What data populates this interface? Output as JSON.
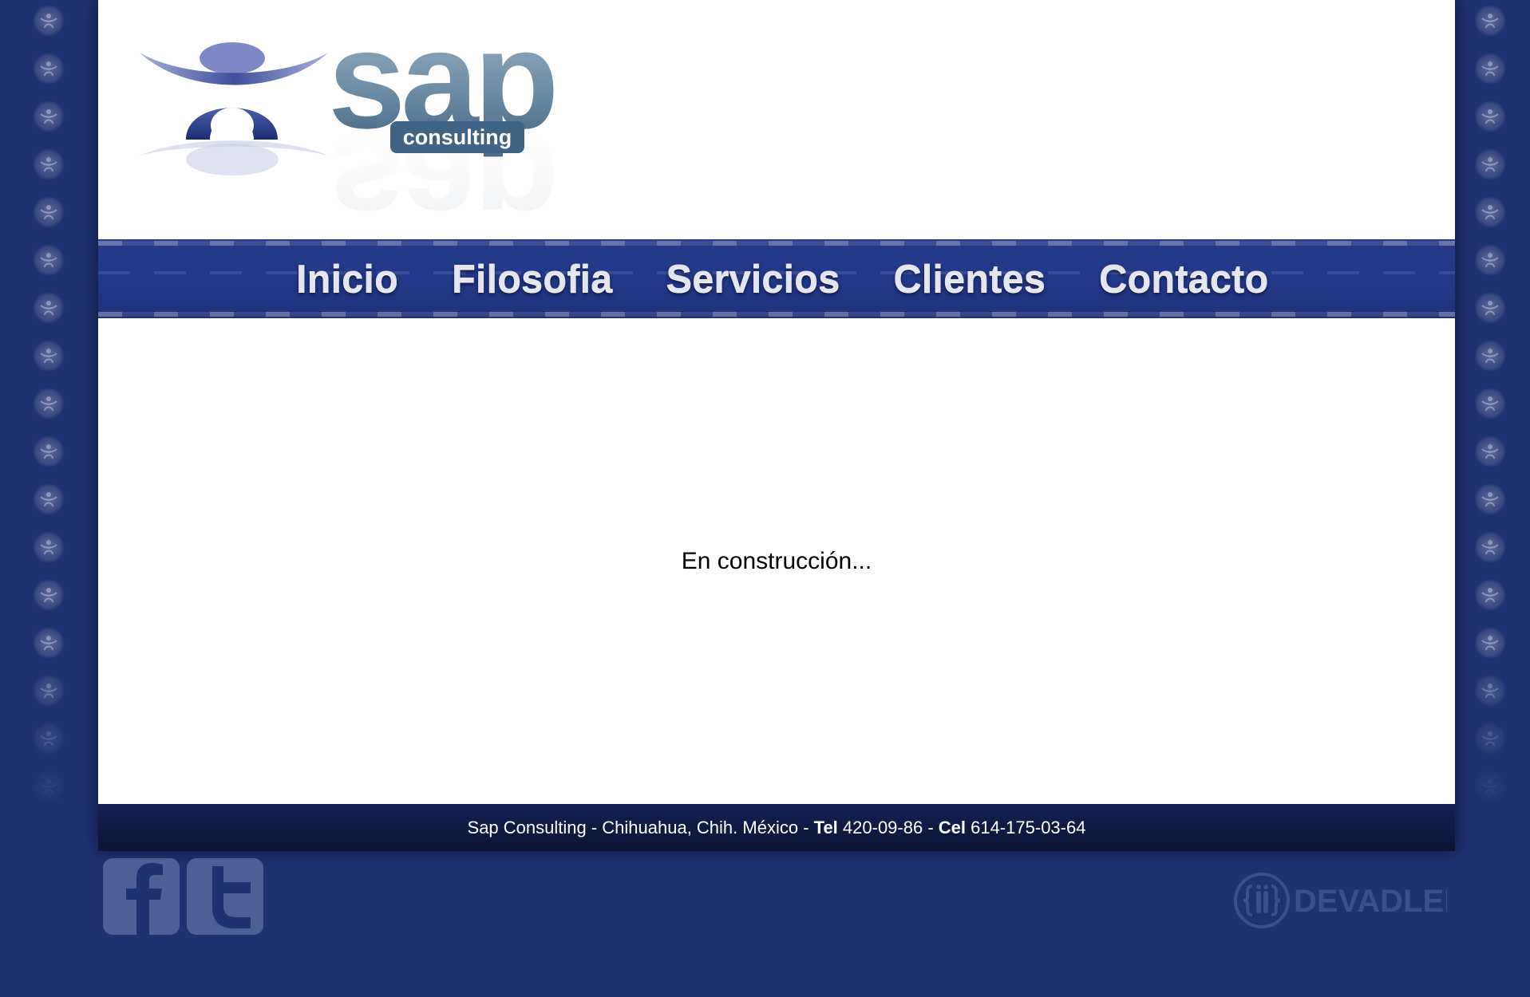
{
  "brand": {
    "logo_main": "sap",
    "logo_sub": "consulting"
  },
  "nav": {
    "items": [
      {
        "label": "Inicio"
      },
      {
        "label": "Filosofia"
      },
      {
        "label": "Servicios"
      },
      {
        "label": "Clientes"
      },
      {
        "label": "Contacto"
      }
    ]
  },
  "content": {
    "message": "En construcción..."
  },
  "footer": {
    "company": "Sap Consulting - Chihuahua, Chih. México - ",
    "tel_label": "Tel",
    "tel_value": " 420-09-86 - ",
    "cel_label": "Cel",
    "cel_value": " 614-175-03-64"
  },
  "social": {
    "facebook_icon": "facebook-icon",
    "twitter_icon": "twitter-icon"
  },
  "credit": {
    "name": "DEVADLER"
  },
  "colors": {
    "background": "#1e3272",
    "nav_bar": "#22388a",
    "footer": "#0b1433",
    "logo_blue": "#2d4a8c",
    "logo_gray": "#5f8099"
  }
}
